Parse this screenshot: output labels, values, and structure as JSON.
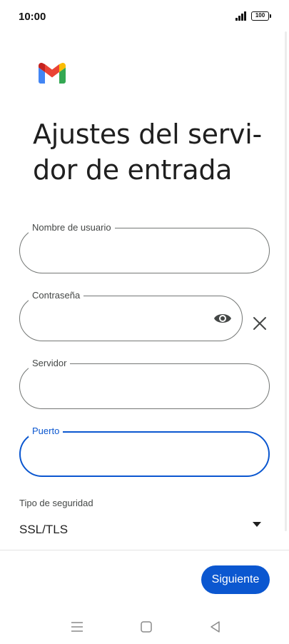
{
  "status_bar": {
    "time": "10:00",
    "battery": "100",
    "signal_icon": "signal-bars-icon"
  },
  "app": {
    "logo": "gmail-logo",
    "colors": {
      "red": "#EA4335",
      "blue": "#4285F4",
      "green": "#34A853",
      "yellow": "#FBBC04"
    }
  },
  "page": {
    "title": "Ajustes del servi-dor de entrada"
  },
  "fields": {
    "username": {
      "label": "Nombre de usuario",
      "value": ""
    },
    "password": {
      "label": "Contraseña",
      "value": ""
    },
    "server": {
      "label": "Servidor",
      "value": ""
    },
    "port": {
      "label": "Puerto",
      "value": "",
      "focused": true
    }
  },
  "security": {
    "label": "Tipo de seguridad",
    "value": "SSL/TLS"
  },
  "actions": {
    "next_label": "Siguiente"
  },
  "nav": {
    "menu_icon": "menu-icon",
    "home_icon": "home-icon",
    "back_icon": "back-icon"
  },
  "colors": {
    "accent": "#0B57D0",
    "outline": "#747775",
    "text": "#1F1F1F"
  }
}
